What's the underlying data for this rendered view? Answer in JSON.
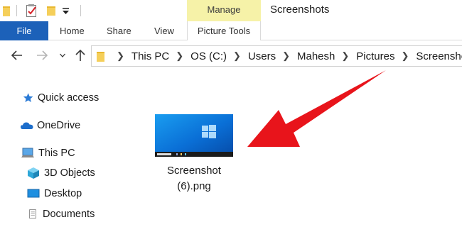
{
  "titlebar": {
    "window_title": "Screenshots",
    "context_group": "Manage",
    "qat_icons": [
      "folder-icon",
      "properties-icon",
      "new-folder-icon",
      "customize-arrow-icon"
    ]
  },
  "ribbon": {
    "file_label": "File",
    "tabs": [
      {
        "label": "Home"
      },
      {
        "label": "Share"
      },
      {
        "label": "View"
      },
      {
        "label": "Picture Tools"
      }
    ]
  },
  "address": {
    "crumbs": [
      "This PC",
      "OS (C:)",
      "Users",
      "Mahesh",
      "Pictures",
      "Screenshots"
    ]
  },
  "nav_pane": {
    "items": [
      {
        "label": "Quick access",
        "icon": "star-icon"
      },
      {
        "label": "OneDrive",
        "icon": "cloud-icon"
      },
      {
        "label": "This PC",
        "icon": "computer-icon"
      },
      {
        "label": "3D Objects",
        "icon": "cube-icon"
      },
      {
        "label": "Desktop",
        "icon": "desktop-icon"
      },
      {
        "label": "Documents",
        "icon": "document-icon"
      }
    ]
  },
  "content": {
    "file": {
      "name_line1": "Screenshot",
      "name_line2": "(6).png"
    }
  },
  "colors": {
    "file_tab": "#1c61b9",
    "manage_tab": "#f6f2a8",
    "annotation_arrow": "#e8141b",
    "folder_yellow": "#f0c94a"
  }
}
